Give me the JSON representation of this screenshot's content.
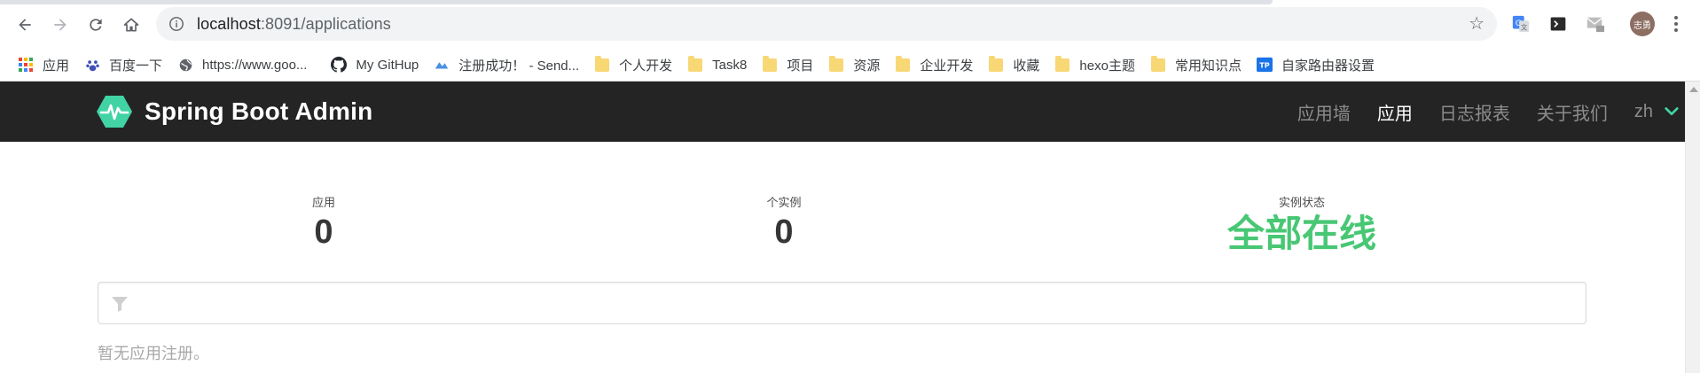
{
  "browser": {
    "url_host": "localhost",
    "url_port_path": ":8091/applications",
    "avatar_text": "志勇",
    "bookmarks": [
      {
        "label": "应用",
        "icon": "apps-grid-icon"
      },
      {
        "label": "百度一下",
        "icon": "baidu-paw-icon"
      },
      {
        "label": "https://www.goo...",
        "icon": "globe-icon"
      },
      {
        "label": "My GitHup",
        "icon": "github-icon"
      },
      {
        "label": "注册成功！ - Send...",
        "icon": "sendcloud-icon"
      },
      {
        "label": "个人开发",
        "icon": "folder-icon"
      },
      {
        "label": "Task8",
        "icon": "folder-icon"
      },
      {
        "label": "项目",
        "icon": "folder-icon"
      },
      {
        "label": "资源",
        "icon": "folder-icon"
      },
      {
        "label": "企业开发",
        "icon": "folder-icon"
      },
      {
        "label": "收藏",
        "icon": "folder-icon"
      },
      {
        "label": "hexo主题",
        "icon": "folder-icon"
      },
      {
        "label": "常用知识点",
        "icon": "folder-icon"
      },
      {
        "label": "自家路由器设置",
        "icon": "tp-link-icon"
      }
    ]
  },
  "app": {
    "title": "Spring Boot Admin",
    "nav": {
      "wallboard": "应用墙",
      "applications": "应用",
      "journal": "日志报表",
      "about": "关于我们",
      "language": "zh"
    }
  },
  "stats": {
    "applications_label": "应用",
    "applications_value": "0",
    "instances_label": "个实例",
    "instances_value": "0",
    "status_label": "实例状态",
    "status_value": "全部在线"
  },
  "filter": {
    "placeholder": ""
  },
  "empty_message": "暂无应用注册。",
  "colors": {
    "navbar_bg": "#242424",
    "accent": "#42d3a5",
    "status_green": "#48c774"
  }
}
